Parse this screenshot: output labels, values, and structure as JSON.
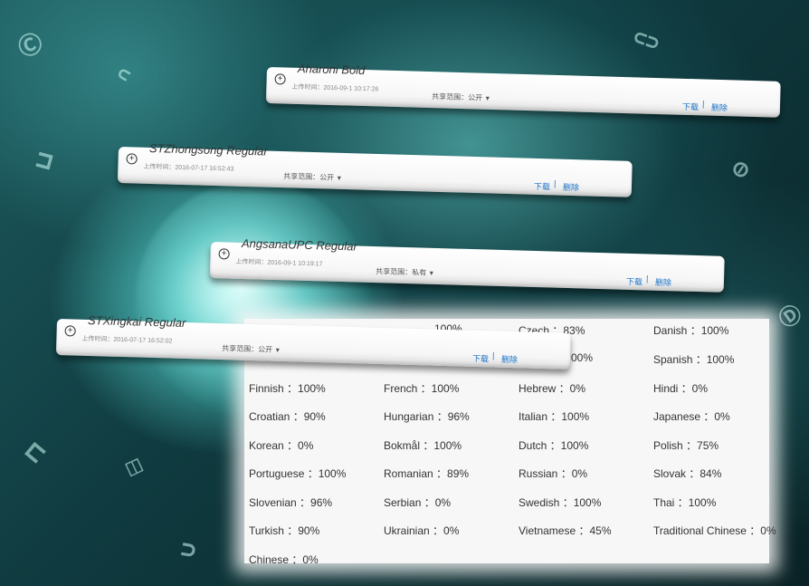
{
  "fonts": [
    {
      "name": "Aharoni Bold",
      "upload": "上传时间：2016-09-1 10:17:26",
      "share_label": "共享范围：",
      "share_value": "公开",
      "download": "下载",
      "separator": "|",
      "delete": "删除"
    },
    {
      "name": "STZhongsong Regular",
      "upload": "上传时间：2016-07-17 16:52:43",
      "share_label": "共享范围：",
      "share_value": "公开",
      "download": "下载",
      "separator": "|",
      "delete": "删除"
    },
    {
      "name": "AngsanaUPC Regular",
      "upload": "上传时间：2016-09-1 10:19:17",
      "share_label": "共享范围：",
      "share_value": "私有",
      "download": "下载",
      "separator": "|",
      "delete": "删除"
    },
    {
      "name": "STXingkai Regular",
      "upload": "上传时间：2016-07-17 16:52:02",
      "share_label": "共享范围：",
      "share_value": "公开",
      "download": "下载",
      "separator": "|",
      "delete": "删除"
    }
  ],
  "languages": [
    {
      "text": "100%"
    },
    {
      "text": "Czech ：83%"
    },
    {
      "text": "Danish ：100%"
    },
    {
      "text": "00%"
    },
    {
      "text": "Spanish ：100%"
    },
    {
      "text": "Finnish ：100%"
    },
    {
      "text": "French ：100%"
    },
    {
      "text": "Hebrew ：0%"
    },
    {
      "text": "Hindi ：0%"
    },
    {
      "text": "Croatian ：90%"
    },
    {
      "text": "Hungarian ：96%"
    },
    {
      "text": "Italian ：100%"
    },
    {
      "text": "Japanese ：0%"
    },
    {
      "text": "Korean ：0%"
    },
    {
      "text": "Bokmål ：100%"
    },
    {
      "text": "Dutch ：100%"
    },
    {
      "text": "Polish ：75%"
    },
    {
      "text": "Portuguese ：100%"
    },
    {
      "text": "Romanian ：89%"
    },
    {
      "text": "Russian ：0%"
    },
    {
      "text": "Slovak ：84%"
    },
    {
      "text": "Slovenian ：96%"
    },
    {
      "text": "Serbian ：0%"
    },
    {
      "text": "Swedish ：100%"
    },
    {
      "text": "Thai ：100%"
    },
    {
      "text": "Turkish ：90%"
    },
    {
      "text": "Ukrainian ：0%"
    },
    {
      "text": "Vietnamese ：45%"
    },
    {
      "text": "Traditional Chinese ：0%"
    },
    {
      "text": "Chinese ：0%"
    }
  ],
  "icons": {
    "add": "add-circle-icon",
    "caret": "caret-down-icon"
  }
}
